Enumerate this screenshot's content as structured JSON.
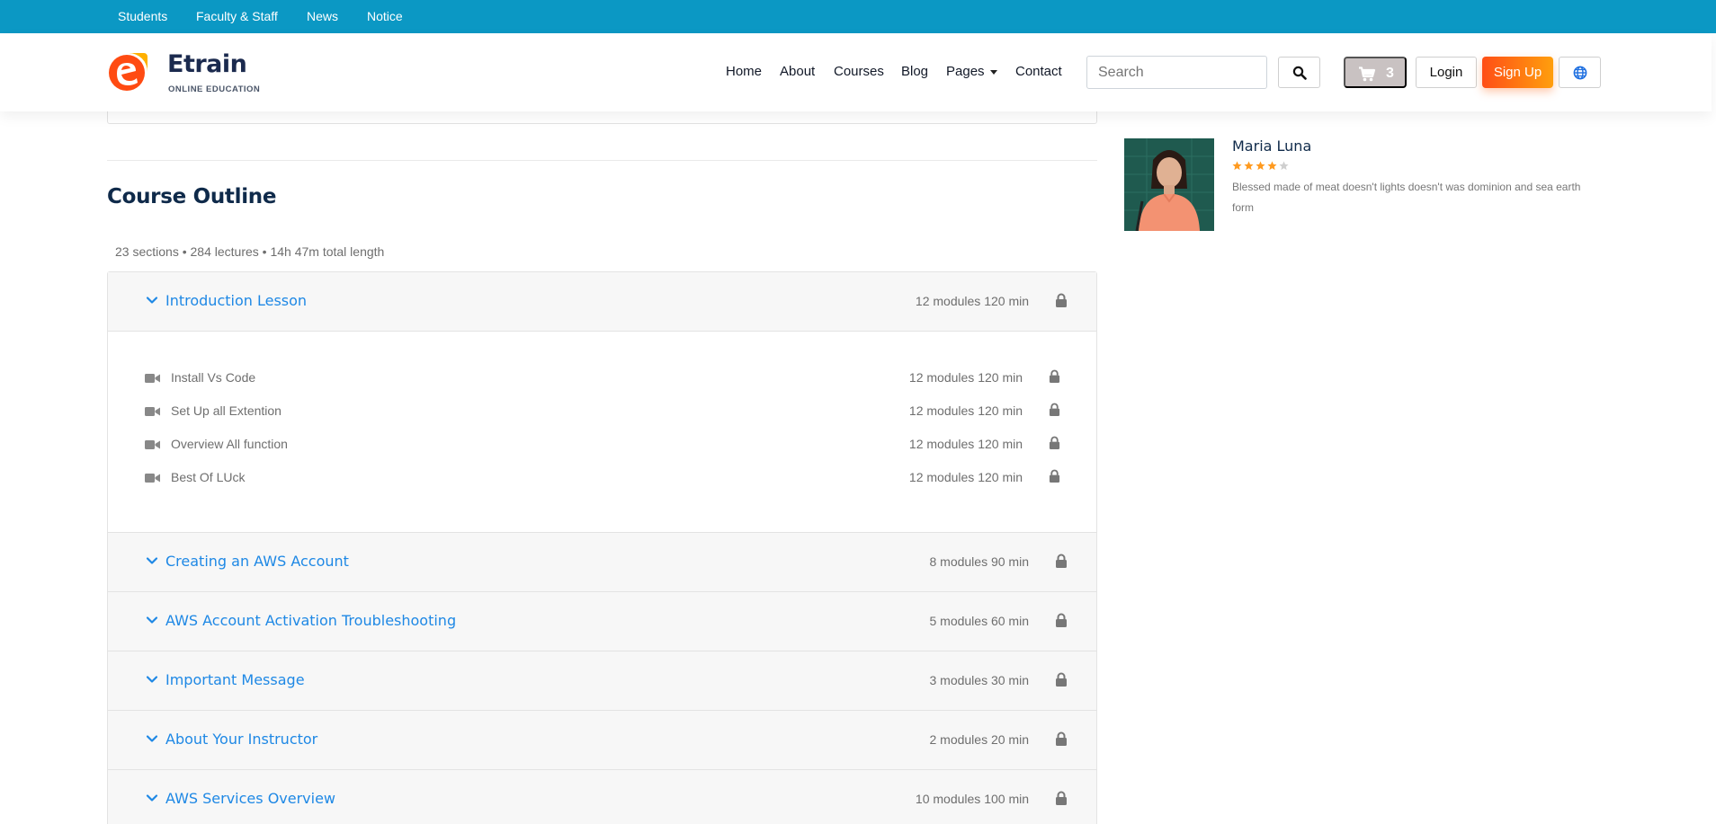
{
  "topbar": {
    "links": [
      "Students",
      "Faculty & Staff",
      "News",
      "Notice"
    ]
  },
  "brand": {
    "name": "Etrain",
    "tagline": "ONLINE EDUCATION",
    "colors": {
      "primary": "#0b98c4",
      "accent": "#ff4e16",
      "link": "#1e88e5"
    }
  },
  "nav": {
    "items": [
      "Home",
      "About",
      "Courses",
      "Blog",
      "Pages",
      "Contact"
    ]
  },
  "search": {
    "placeholder": "Search",
    "icon": "search-icon"
  },
  "cart": {
    "count": "3",
    "icon": "cart-icon"
  },
  "auth": {
    "login_label": "Login",
    "signup_label": "Sign Up"
  },
  "language": {
    "icon": "globe-icon"
  },
  "outline": {
    "title": "Course Outline",
    "summary": "23 sections • 284 lectures • 14h 47m total length",
    "sections": [
      {
        "title": "Introduction Lesson",
        "meta": "12 modules 120 min",
        "expanded": true,
        "lectures": [
          {
            "title": "Install Vs Code",
            "meta": "12 modules 120 min"
          },
          {
            "title": "Set Up all Extention",
            "meta": "12 modules 120 min"
          },
          {
            "title": "Overview All function",
            "meta": "12 modules 120 min"
          },
          {
            "title": "Best Of LUck",
            "meta": "12 modules 120 min"
          }
        ]
      },
      {
        "title": "Creating an AWS Account",
        "meta": "8 modules 90 min",
        "expanded": false
      },
      {
        "title": "AWS Account Activation Troubleshooting",
        "meta": "5 modules 60 min",
        "expanded": false
      },
      {
        "title": "Important Message",
        "meta": "3 modules 30 min",
        "expanded": false
      },
      {
        "title": "About Your Instructor",
        "meta": "2 modules 20 min",
        "expanded": false
      },
      {
        "title": "AWS Services Overview",
        "meta": "10 modules 100 min",
        "expanded": false
      }
    ]
  },
  "instructor": {
    "name": "Maria Luna",
    "rating": 4,
    "rating_max": 5,
    "bio": "Blessed made of meat doesn't lights doesn't was dominion and sea earth form"
  }
}
